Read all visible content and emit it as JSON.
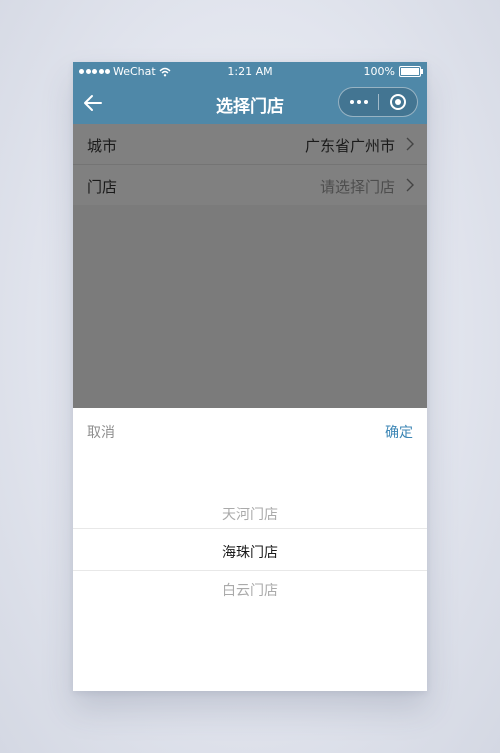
{
  "status_bar": {
    "carrier": "WeChat",
    "time": "1:21 AM",
    "battery": "100%"
  },
  "nav": {
    "title": "选择门店"
  },
  "form": {
    "rows": [
      {
        "label": "城市",
        "value": "广东省广州市"
      },
      {
        "label": "门店",
        "value": "请选择门店"
      }
    ]
  },
  "picker": {
    "cancel_label": "取消",
    "confirm_label": "确定",
    "options": [
      "天河门店",
      "海珠门店",
      "白云门店"
    ],
    "selected": "海珠门店"
  },
  "colors": {
    "brand": "#4f88a8",
    "accent": "#3c86b5",
    "overlay": "#7b7b7b"
  }
}
